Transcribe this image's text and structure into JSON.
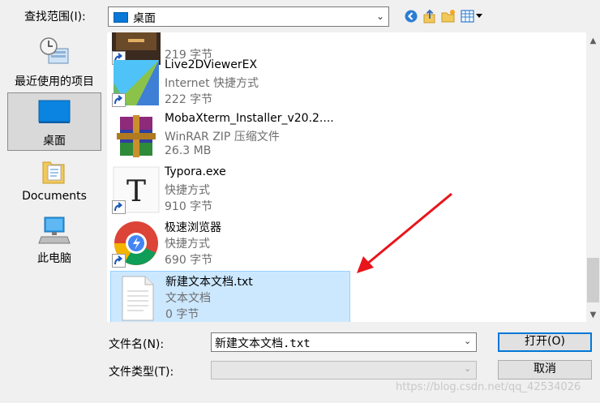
{
  "lookin": {
    "label": "查找范围(I):",
    "value": "桌面"
  },
  "places": [
    {
      "label": "最近使用的项目",
      "icon": "recent-items-icon"
    },
    {
      "label": "桌面",
      "icon": "desktop-icon"
    },
    {
      "label": "Documents",
      "icon": "documents-folder-icon"
    },
    {
      "label": "此电脑",
      "icon": "this-pc-icon"
    }
  ],
  "files": [
    {
      "name": "",
      "type": "",
      "size": "219 字节",
      "icon": "game-shortcut-icon"
    },
    {
      "name": "Live2DViewerEX",
      "type": "Internet 快捷方式",
      "size": "222 字节",
      "icon": "live2d-icon"
    },
    {
      "name": "MobaXterm_Installer_v20.2....",
      "type": "WinRAR ZIP 压缩文件",
      "size": "26.3 MB",
      "icon": "winrar-archive-icon"
    },
    {
      "name": "Typora.exe",
      "type": "快捷方式",
      "size": "910 字节",
      "icon": "typora-icon"
    },
    {
      "name": "极速浏览器",
      "type": "快捷方式",
      "size": "690 字节",
      "icon": "browser-icon"
    },
    {
      "name": "新建文本文档.txt",
      "type": "文本文档",
      "size": "0 字节",
      "icon": "text-document-icon"
    }
  ],
  "form": {
    "filename_label": "文件名(N):",
    "filename_value": "新建文本文档.txt",
    "filetype_label": "文件类型(T):",
    "filetype_value": "",
    "open_label": "打开(O)",
    "cancel_label": "取消"
  },
  "watermark": "https://blog.csdn.net/qq_42534026",
  "colors": {
    "accent": "#0078d7",
    "selection": "#cce8ff",
    "annotation_arrow": "#e8151b"
  }
}
